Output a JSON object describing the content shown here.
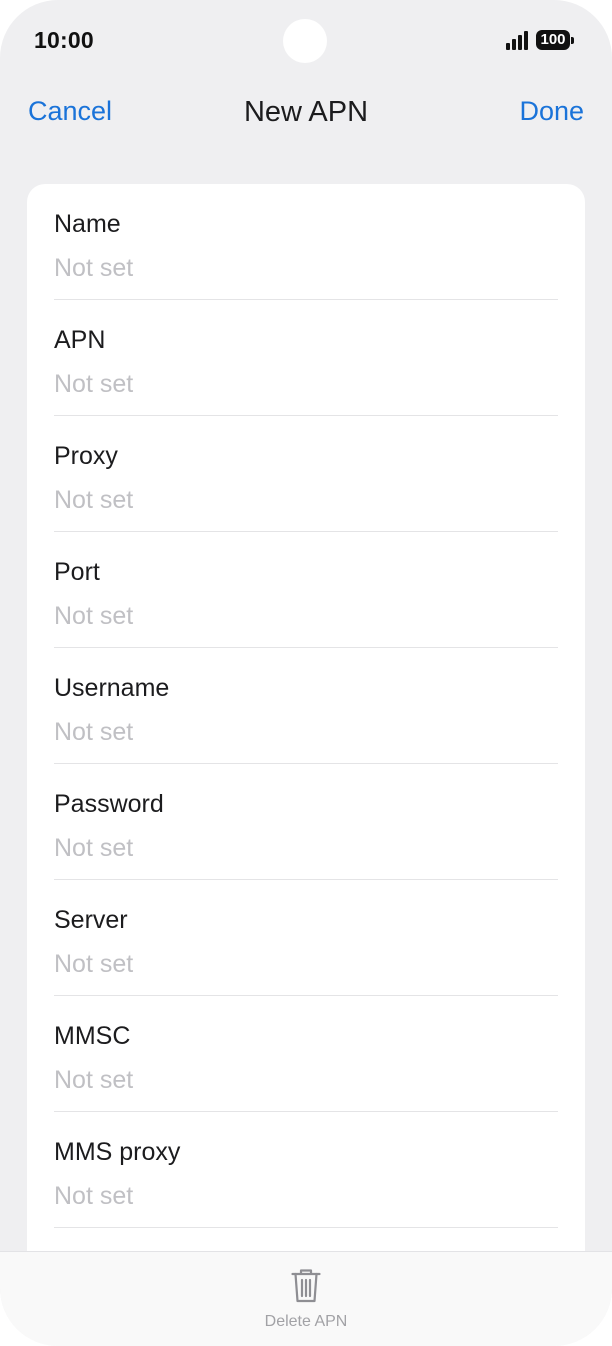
{
  "status_bar": {
    "time": "10:00",
    "battery": "100",
    "icons": [
      "signal-icon",
      "battery-icon"
    ]
  },
  "nav": {
    "cancel_label": "Cancel",
    "title": "New APN",
    "done_label": "Done"
  },
  "fields": [
    {
      "label": "Name",
      "value": "Not set"
    },
    {
      "label": "APN",
      "value": "Not set"
    },
    {
      "label": "Proxy",
      "value": "Not set"
    },
    {
      "label": "Port",
      "value": "Not set"
    },
    {
      "label": "Username",
      "value": "Not set"
    },
    {
      "label": "Password",
      "value": "Not set"
    },
    {
      "label": "Server",
      "value": "Not set"
    },
    {
      "label": "MMSC",
      "value": "Not set"
    },
    {
      "label": "MMS proxy",
      "value": "Not set"
    }
  ],
  "toolbar": {
    "delete_label": "Delete APN",
    "delete_icon": "trash-icon"
  },
  "colors": {
    "accent": "#1a73d9",
    "background": "#efeff1",
    "placeholder": "#c0c0c4"
  }
}
